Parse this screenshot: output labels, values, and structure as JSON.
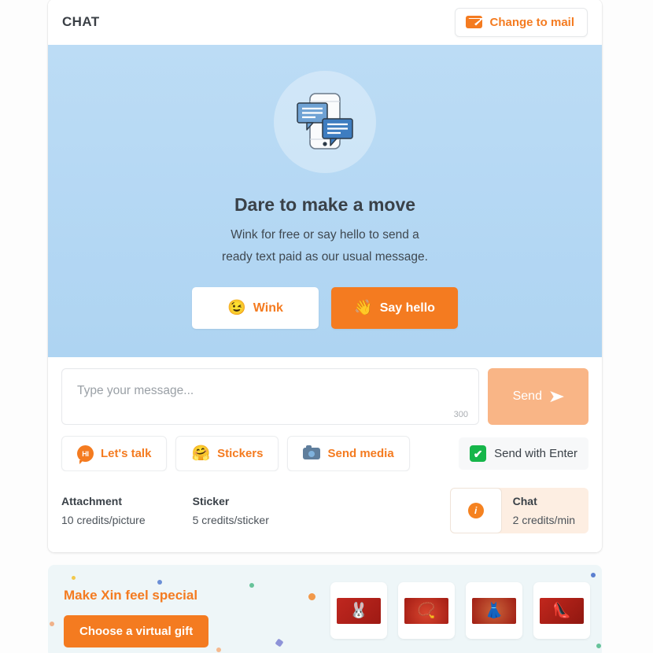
{
  "header": {
    "title": "CHAT",
    "change_to_mail_label": "Change to mail",
    "mail_icon": "envelope-icon"
  },
  "hero": {
    "illustration": "phone-chat-bubbles-illustration",
    "heading": "Dare to make a move",
    "line1": "Wink for free or say hello to send a",
    "line2": "ready text paid as our usual message.",
    "wink_label": "Wink",
    "wink_emoji": "😉",
    "hello_label": "Say hello",
    "hello_emoji": "👋"
  },
  "composer": {
    "placeholder": "Type your message...",
    "value": "",
    "char_count": "300",
    "send_label": "Send",
    "send_icon": "paper-plane-icon"
  },
  "actions": {
    "lets_talk_label": "Let's talk",
    "lets_talk_icon_text": "HI",
    "stickers_label": "Stickers",
    "stickers_emoji": "🤗",
    "send_media_label": "Send media",
    "send_media_icon": "camera-icon",
    "send_with_enter_label": "Send with Enter",
    "send_with_enter_checked": "✔"
  },
  "credits": {
    "attachment_title": "Attachment",
    "attachment_value": "10 credits/picture",
    "sticker_title": "Sticker",
    "sticker_value": "5 credits/sticker",
    "chat_title": "Chat",
    "chat_value": "2 credits/min",
    "info_icon_text": "i"
  },
  "gift": {
    "heading": "Make Xin feel special",
    "button_label": "Choose a virtual gift",
    "thumbs": [
      {
        "name": "rabbit-figurine-gift",
        "emoji": "🐰"
      },
      {
        "name": "necklace-gift",
        "emoji": "📿"
      },
      {
        "name": "red-dress-gift",
        "emoji": "👗"
      },
      {
        "name": "gold-shoe-gift",
        "emoji": "👠"
      }
    ]
  },
  "colors": {
    "brand_orange": "#f47b20",
    "hero_blue_top": "#bcdcf5",
    "hero_blue_bottom": "#aed4f2",
    "send_disabled": "#f9b586",
    "check_green": "#16b64a",
    "gift_bg": "#eef6f8"
  }
}
